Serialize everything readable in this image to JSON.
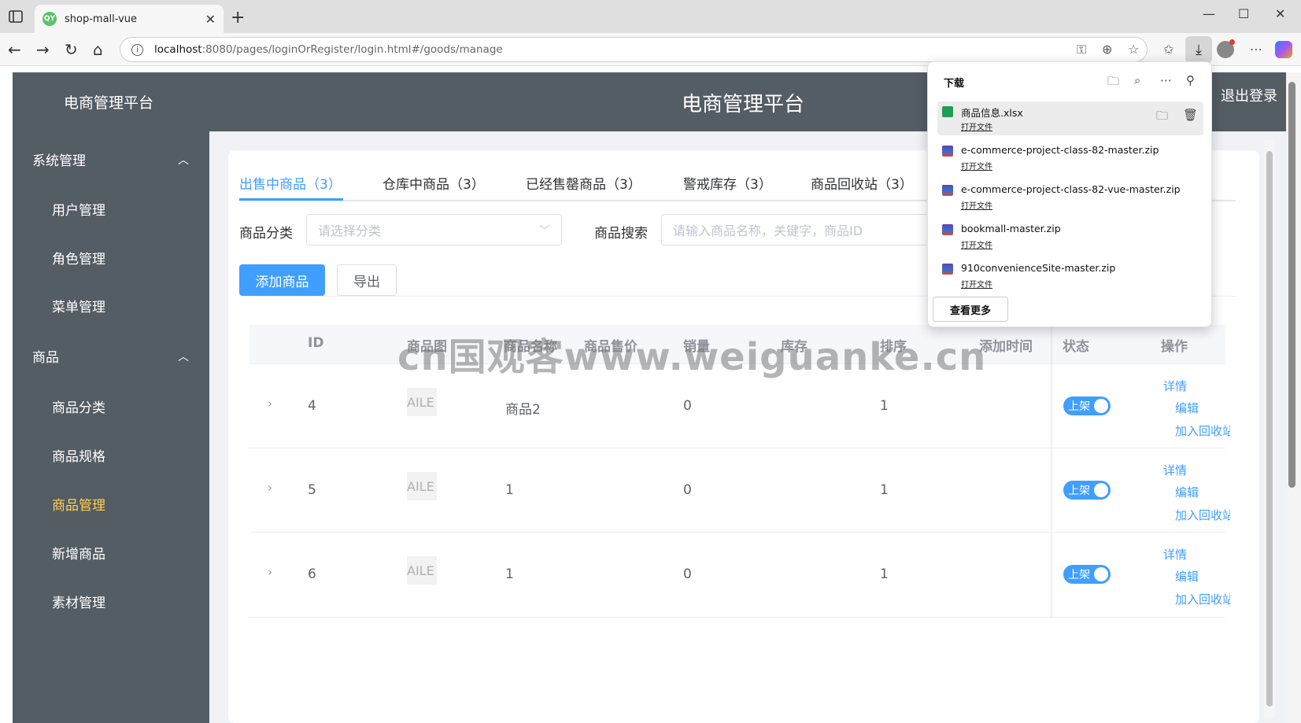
{
  "browser": {
    "tab_title": "shop-mall-vue",
    "favicon_text": "QY",
    "url_host": "localhost",
    "url_rest": ":8080/pages/loginOrRegister/login.html#/goods/manage"
  },
  "downloads": {
    "title": "下载",
    "items": [
      {
        "name": "商品信息.xlsx",
        "open": "打开文件",
        "type": "xlsx"
      },
      {
        "name": "e-commerce-project-class-82-master.zip",
        "open": "打开文件",
        "type": "zip"
      },
      {
        "name": "e-commerce-project-class-82-vue-master.zip",
        "open": "打开文件",
        "type": "zip"
      },
      {
        "name": "bookmall-master.zip",
        "open": "打开文件",
        "type": "zip"
      },
      {
        "name": "910convenienceSite-master.zip",
        "open": "打开文件",
        "type": "zip"
      }
    ],
    "more_label": "查看更多"
  },
  "header": {
    "logo": "电商管理平台",
    "title": "电商管理平台",
    "logout": "退出登录"
  },
  "sidebar": {
    "groups": [
      {
        "label": "系统管理",
        "items": [
          "用户管理",
          "角色管理",
          "菜单管理"
        ]
      },
      {
        "label": "商品",
        "items": [
          "商品分类",
          "商品规格",
          "商品管理",
          "新增商品",
          "素材管理"
        ]
      }
    ],
    "active": "商品管理"
  },
  "goods_tabs": [
    "出售中商品（3）",
    "仓库中商品（3）",
    "已经售罄商品（3）",
    "警戒库存（3）",
    "商品回收站（3）"
  ],
  "filters": {
    "category_label": "商品分类",
    "category_placeholder": "请选择分类",
    "search_label": "商品搜索",
    "search_placeholder": "请输入商品名称，关键字，商品ID"
  },
  "buttons": {
    "add": "添加商品",
    "export": "导出"
  },
  "table": {
    "headers": [
      "ID",
      "商品图",
      "商品名称",
      "商品售价",
      "销量",
      "库存",
      "排序",
      "添加时间",
      "状态",
      "操作"
    ],
    "rows": [
      {
        "id": "4",
        "img": "AILE",
        "name": "商品2",
        "price": "",
        "sales": "0",
        "stock": "",
        "sort": "1",
        "status": "上架"
      },
      {
        "id": "5",
        "img": "AILE",
        "name": "1",
        "price": "",
        "sales": "0",
        "stock": "",
        "sort": "1",
        "status": "上架"
      },
      {
        "id": "6",
        "img": "AILE",
        "name": "1",
        "price": "",
        "sales": "0",
        "stock": "",
        "sort": "1",
        "status": "上架"
      }
    ],
    "ops": [
      "详情",
      "编辑",
      "加入回收站"
    ]
  },
  "watermark": "cn国观客www.weiguanke.cn",
  "colors": {
    "primary": "#409eff",
    "sidebar": "#545c64",
    "active_menu": "#ffd04b"
  }
}
